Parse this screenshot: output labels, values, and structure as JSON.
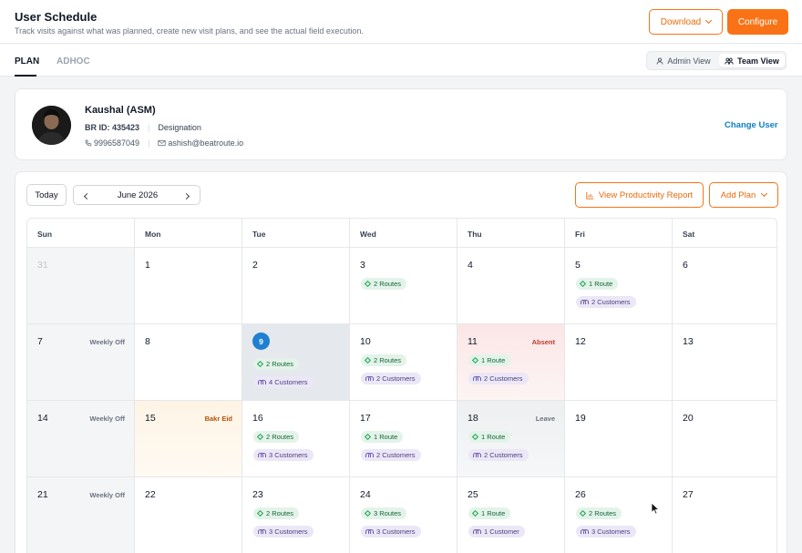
{
  "header": {
    "title": "User Schedule",
    "subtitle": "Track visits against what was planned, create new visit plans, and see the actual field execution.",
    "download_label": "Download",
    "configure_label": "Configure"
  },
  "tabs": {
    "plan": "PLAN",
    "adhoc": "ADHOC",
    "admin_view": "Admin View",
    "team_view": "Team View",
    "active_view": "Team View"
  },
  "user": {
    "name": "Kaushal (ASM)",
    "br_id_label": "BR ID: 435423",
    "designation": "Designation",
    "phone": "9996587049",
    "email": "ashish@beatroute.io",
    "change_label": "Change User"
  },
  "calendar": {
    "today_label": "Today",
    "month_label": "June 2026",
    "report_label": "View Productivity Report",
    "add_plan_label": "Add Plan",
    "weekdays": [
      "Sun",
      "Mon",
      "Tue",
      "Wed",
      "Thu",
      "Fri",
      "Sat"
    ],
    "weeks": [
      [
        {
          "day": "31",
          "muted": true
        },
        {
          "day": "1"
        },
        {
          "day": "2"
        },
        {
          "day": "3",
          "route": "2 Routes"
        },
        {
          "day": "4"
        },
        {
          "day": "5",
          "route": "1 Route",
          "cust": "2 Customers"
        },
        {
          "day": "6"
        }
      ],
      [
        {
          "day": "7",
          "status": "Weekly Off"
        },
        {
          "day": "8"
        },
        {
          "day": "9",
          "today": true,
          "route": "2 Routes",
          "cust": "4 Customers"
        },
        {
          "day": "10",
          "route": "2 Routes",
          "cust": "2 Customers"
        },
        {
          "day": "11",
          "status": "Absent",
          "route": "1 Route",
          "cust": "2 Customers"
        },
        {
          "day": "12"
        },
        {
          "day": "13"
        }
      ],
      [
        {
          "day": "14",
          "status": "Weekly Off"
        },
        {
          "day": "15",
          "status": "Bakr Eid"
        },
        {
          "day": "16",
          "route": "2 Routes",
          "cust": "3 Customers"
        },
        {
          "day": "17",
          "route": "1 Route",
          "cust": "2 Customers"
        },
        {
          "day": "18",
          "status": "Leave",
          "route": "1 Route",
          "cust": "2 Customers"
        },
        {
          "day": "19"
        },
        {
          "day": "20"
        }
      ],
      [
        {
          "day": "21",
          "status": "Weekly Off"
        },
        {
          "day": "22"
        },
        {
          "day": "23",
          "route": "2 Routes",
          "cust": "3 Customers"
        },
        {
          "day": "24",
          "route": "3 Routes",
          "cust": "3 Customers"
        },
        {
          "day": "25",
          "route": "1 Route",
          "cust": "1 Customer"
        },
        {
          "day": "26",
          "route": "2 Routes",
          "cust": "3 Customers"
        },
        {
          "day": "27"
        }
      ]
    ]
  }
}
